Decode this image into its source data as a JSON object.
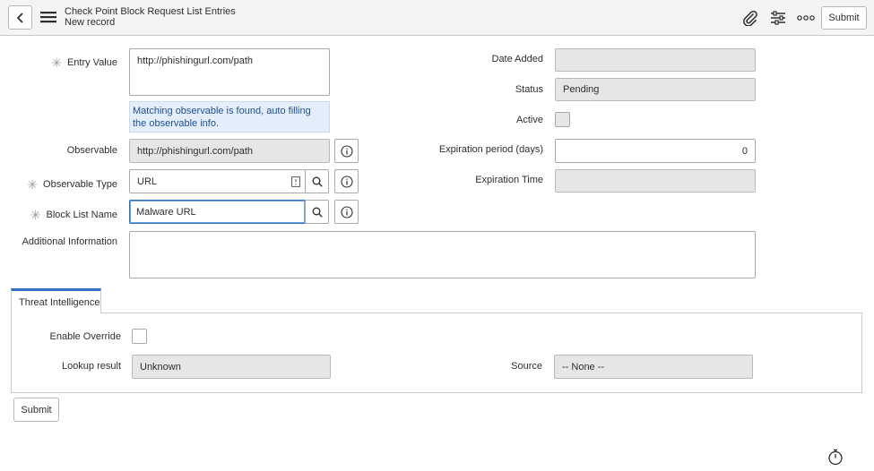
{
  "header": {
    "title": "Check Point Block Request List Entries",
    "subtitle": "New record",
    "submit_label": "Submit"
  },
  "form": {
    "entry_value": {
      "label": "Entry Value",
      "value": "http://phishingurl.com/path"
    },
    "info_message": "Matching observable is found, auto filling the observable info.",
    "observable": {
      "label": "Observable",
      "value": "http://phishingurl.com/path"
    },
    "observable_type": {
      "label": "Observable Type",
      "value": "URL"
    },
    "block_list_name": {
      "label": "Block List Name",
      "value": "Malware URL"
    },
    "additional_information": {
      "label": "Additional Information",
      "value": ""
    },
    "date_added": {
      "label": "Date Added",
      "value": ""
    },
    "status": {
      "label": "Status",
      "value": "Pending"
    },
    "active": {
      "label": "Active",
      "checked": false
    },
    "expiration_period": {
      "label": "Expiration period (days)",
      "value": "0"
    },
    "expiration_time": {
      "label": "Expiration Time",
      "value": ""
    }
  },
  "tabs": [
    {
      "label": "Threat Intelligence",
      "active": true
    }
  ],
  "threat_intel": {
    "enable_override": {
      "label": "Enable Override",
      "checked": false
    },
    "lookup_result": {
      "label": "Lookup result",
      "value": "Unknown"
    },
    "source": {
      "label": "Source",
      "value": "-- None --"
    }
  },
  "footer": {
    "submit_label": "Submit"
  },
  "icons": {
    "back": "chevron-left-icon",
    "menu": "hamburger-icon",
    "attachment": "paperclip-icon",
    "settings": "sliders-icon",
    "more": "ellipsis-icon",
    "search": "magnifier-icon",
    "info": "info-circle-icon",
    "reference": "reference-icon",
    "timer": "stopwatch-icon"
  },
  "colors": {
    "accent": "#2d73c2",
    "info_bg": "#e4eefb",
    "info_text": "#1e4f91",
    "readonly_bg": "#e6e6e6"
  }
}
